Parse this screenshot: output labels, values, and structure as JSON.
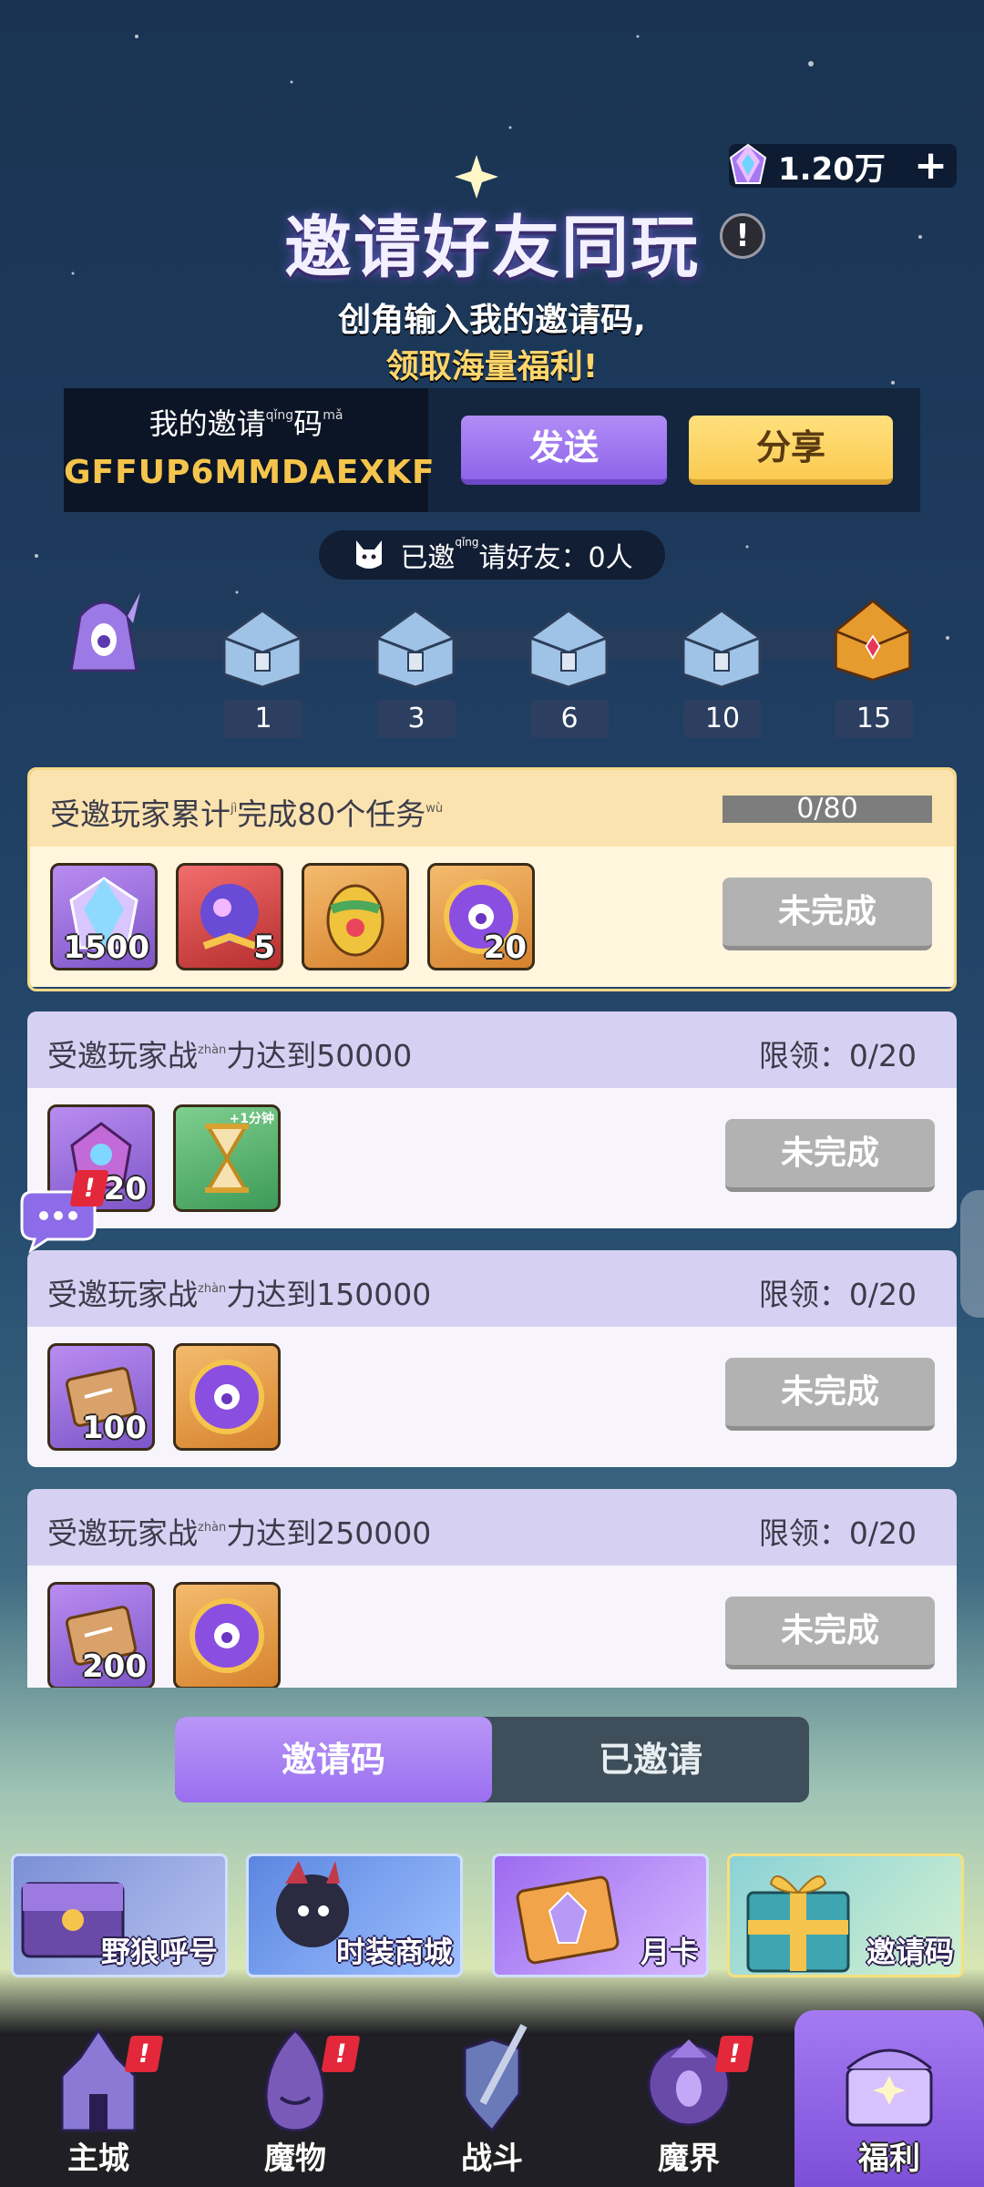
{
  "header": {
    "currency_amount": "1.20万",
    "plus": "+",
    "title": "邀请好友同玩",
    "info": "!",
    "subtitle_line1": "创角输入我的邀请码,",
    "subtitle_line2": "领取海量福利!"
  },
  "invite": {
    "label_pre": "我的邀",
    "label_ruby": "qǐng",
    "label_char": "请",
    "label_ruby2": "mǎ",
    "label_char2": "码",
    "code": "GFFUP6MMDAEXKF",
    "send_label": "发送",
    "share_label": "分享",
    "invited_pre": "已邀",
    "invited_ruby": "qǐng",
    "invited_char": "请",
    "invited_post": "好友：0人"
  },
  "milestones": [
    "1",
    "3",
    "6",
    "10",
    "15"
  ],
  "tasks": [
    {
      "title_pre": "受邀玩家累",
      "ruby": "jì",
      "ruby_char": "计",
      "title_mid": "完成80个任",
      "ruby2": "wù",
      "ruby_char2": "务",
      "progress": "0/80",
      "status": "未完成",
      "rewards": [
        "1500",
        "5",
        "",
        "20"
      ]
    },
    {
      "title_pre": "受邀玩家",
      "ruby": "zhàn",
      "ruby_char": "战",
      "title_post": "力达到50000",
      "limit": "限领：0/20",
      "status": "未完成",
      "rewards": [
        "20",
        ""
      ],
      "reward_tag": "+1分钟"
    },
    {
      "title_pre": "受邀玩家",
      "ruby": "zhàn",
      "ruby_char": "战",
      "title_post": "力达到150000",
      "limit": "限领：0/20",
      "status": "未完成",
      "rewards": [
        "100",
        ""
      ]
    },
    {
      "title_pre": "受邀玩家",
      "ruby": "zhàn",
      "ruby_char": "战",
      "title_post": "力达到250000",
      "limit": "限领：0/20",
      "status": "未完成",
      "rewards": [
        "200",
        ""
      ]
    }
  ],
  "tabs": {
    "active": "邀请码",
    "inactive": "已邀请"
  },
  "banners": [
    "野狼呼号",
    "时装商城",
    "月卡",
    "邀请码"
  ],
  "nav": [
    "主城",
    "魔物",
    "战斗",
    "魔界",
    "福利"
  ],
  "colors": {
    "accent_purple": "#9a6ff0",
    "gold": "#fbcb52",
    "badge_red": "#e2283a"
  }
}
